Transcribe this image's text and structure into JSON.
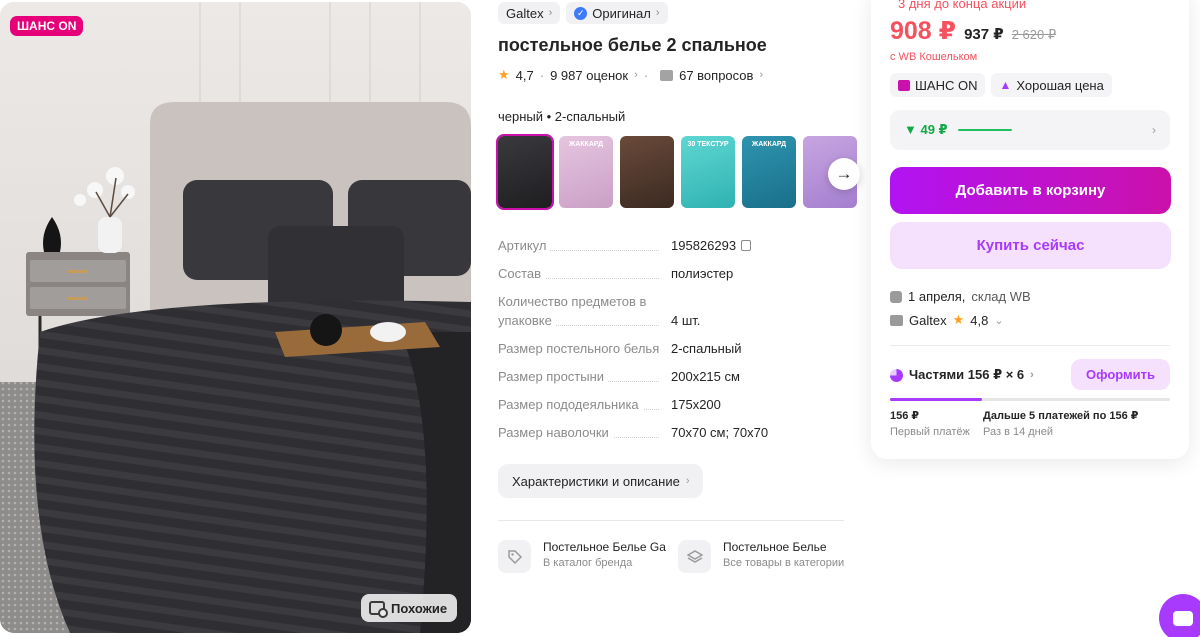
{
  "photo": {
    "badge": "ШАНС ON",
    "similar_label": "Похожие"
  },
  "chips": {
    "brand": "Galtex",
    "original": "Оригинал"
  },
  "product": {
    "title": "постельное белье 2 спальное",
    "rating": "4,7",
    "reviews": "9 987 оценок",
    "questions": "67 вопросов",
    "color_size": "черный • 2-спальный"
  },
  "thumbnails": [
    {
      "colors": [
        "#3a3a3e",
        "#1e1e21"
      ]
    },
    {
      "colors": [
        "#e6c5e0",
        "#c9a0c6"
      ],
      "text": "ЖАККАРД"
    },
    {
      "colors": [
        "#6a4a3a",
        "#3b2a22"
      ]
    },
    {
      "colors": [
        "#5fd7d3",
        "#2fb2b2"
      ],
      "text": "30 ТЕКСТУР"
    },
    {
      "colors": [
        "#2f95b0",
        "#196f8a"
      ],
      "text": "ЖАККАРД"
    },
    {
      "colors": [
        "#c7a5e0",
        "#a47fd0"
      ]
    }
  ],
  "params": [
    {
      "k": "Артикул",
      "v": "195826293",
      "copy": true
    },
    {
      "k": "Состав",
      "v": "полиэстер"
    },
    {
      "k": "Количество предметов в упаковке",
      "v": "4 шт."
    },
    {
      "k": "Размер постельного белья",
      "v": "2-спальный"
    },
    {
      "k": "Размер простыни",
      "v": "200x215 см"
    },
    {
      "k": "Размер пододеяльника",
      "v": "175x200"
    },
    {
      "k": "Размер наволочки",
      "v": "70x70 см; 70x70"
    }
  ],
  "desc_button": "Характеристики и описание",
  "brand_cards": [
    {
      "title": "Постельное Белье Galtex",
      "sub": "В каталог бренда"
    },
    {
      "title": "Постельное Белье",
      "sub": "Все товары в категории"
    }
  ],
  "buy": {
    "timer": "3 дня до конца акции",
    "price": "908 ₽",
    "price_mid": "937 ₽",
    "price_old": "2 620 ₽",
    "wallet": "с WB Кошельком",
    "badge_chance": "ШАНС ON",
    "badge_good": "Хорошая цена",
    "cashback": "▼ 49 ₽",
    "cart_button": "Добавить в корзину",
    "buy_button": "Купить сейчас",
    "delivery_date": "1 апреля,",
    "delivery_from": "склад WB",
    "seller": "Galtex",
    "seller_rating": "4,8",
    "parts": "Частями 156 ₽ × 6",
    "order_button": "Оформить",
    "progress_fraction": 0.33,
    "first_amount": "156 ₽",
    "first_label": "Первый платёж",
    "rest_amount": "Дальше 5 платежей по 156 ₽",
    "rest_label": "Раз в 14 дней"
  },
  "colors": {
    "accent": "#a73afd",
    "price": "#f5515f",
    "brand": "#cb11ab"
  }
}
